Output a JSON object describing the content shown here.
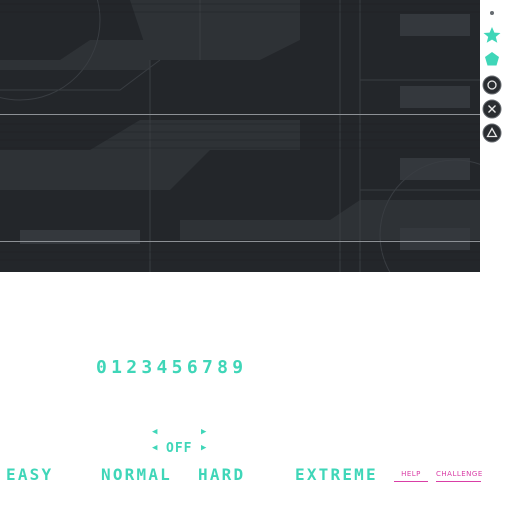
{
  "digits": "0123456789",
  "option": {
    "value": "OFF"
  },
  "difficulties": [
    "EASY",
    "NORMAL",
    "HARD",
    "EXTREME"
  ],
  "buttons": {
    "help": "HELP",
    "challenge": "CHALLENGE"
  },
  "icons": [
    "dot-icon",
    "star-icon",
    "pentagon-icon",
    "circle-button-icon",
    "cross-button-icon",
    "triangle-button-icon"
  ],
  "colors": {
    "accent": "#3fd6b8",
    "pink": "#d93ea6",
    "panel": "#24272b"
  }
}
